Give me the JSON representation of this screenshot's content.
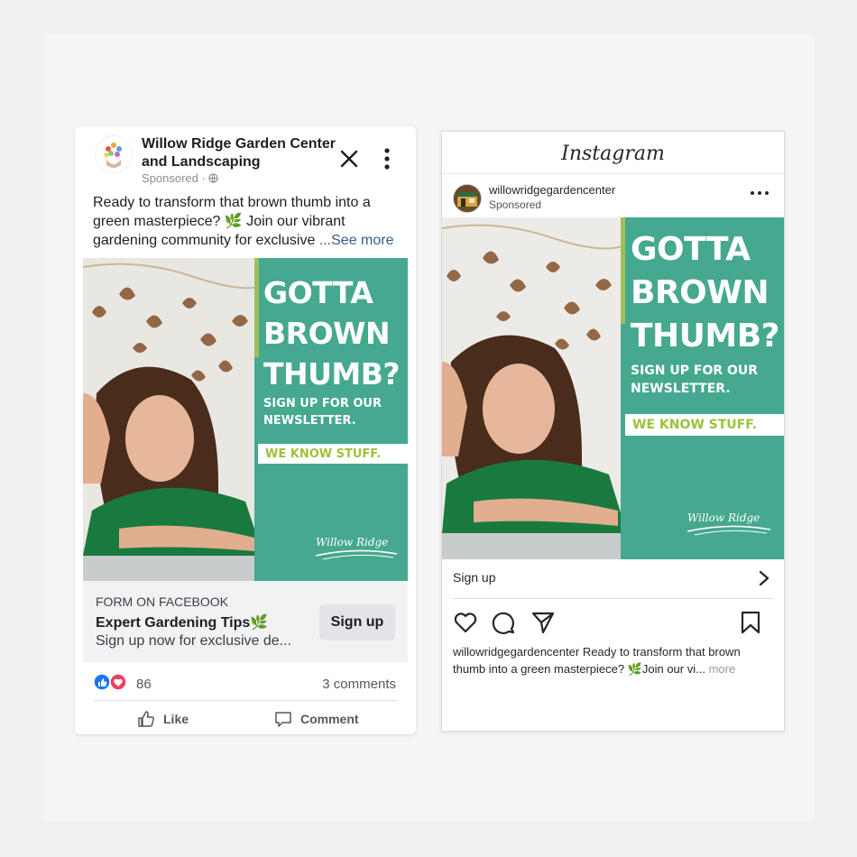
{
  "facebook": {
    "page_name": "Willow Ridge Garden Center and Landscaping",
    "sponsored": "Sponsored · ",
    "post_text": "Ready to transform that brown thumb into a green masterpiece? 🌿 Join our vibrant gardening community for exclusive ",
    "see_more": "...See more",
    "ad": {
      "headline": [
        "GOTTA",
        "BROWN",
        "THUMB?"
      ],
      "subhead": [
        "SIGN UP FOR OUR",
        "NEWSLETTER."
      ],
      "strip": "WE KNOW STUFF.",
      "brand": "Willow Ridge"
    },
    "form_label": "FORM ON FACEBOOK",
    "form_title": "Expert Gardening Tips🌿",
    "form_desc": "Sign up now for exclusive de...",
    "cta_button": "Sign up",
    "reaction_count": "86",
    "comments": "3 comments",
    "like_label": "Like",
    "comment_label": "Comment"
  },
  "instagram": {
    "logo": "Instagram",
    "username": "willowridgegardencenter",
    "sponsored": "Sponsored",
    "ad": {
      "headline": [
        "GOTTA",
        "BROWN",
        "THUMB?"
      ],
      "subhead": [
        "SIGN UP FOR OUR",
        "NEWSLETTER."
      ],
      "strip": "WE KNOW STUFF.",
      "brand": "Willow Ridge"
    },
    "cta": "Sign up",
    "caption_user": "willowridgegardencenter",
    "caption_text": " Ready to transform that brown thumb into a green masterpiece? 🌿Join our vi... ",
    "caption_more": "more"
  },
  "colors": {
    "teal": "#45a88f",
    "lime": "#9bc23a",
    "fb_link": "#3b5b8c",
    "like_blue": "#1877f2",
    "love_red": "#f33e58"
  }
}
